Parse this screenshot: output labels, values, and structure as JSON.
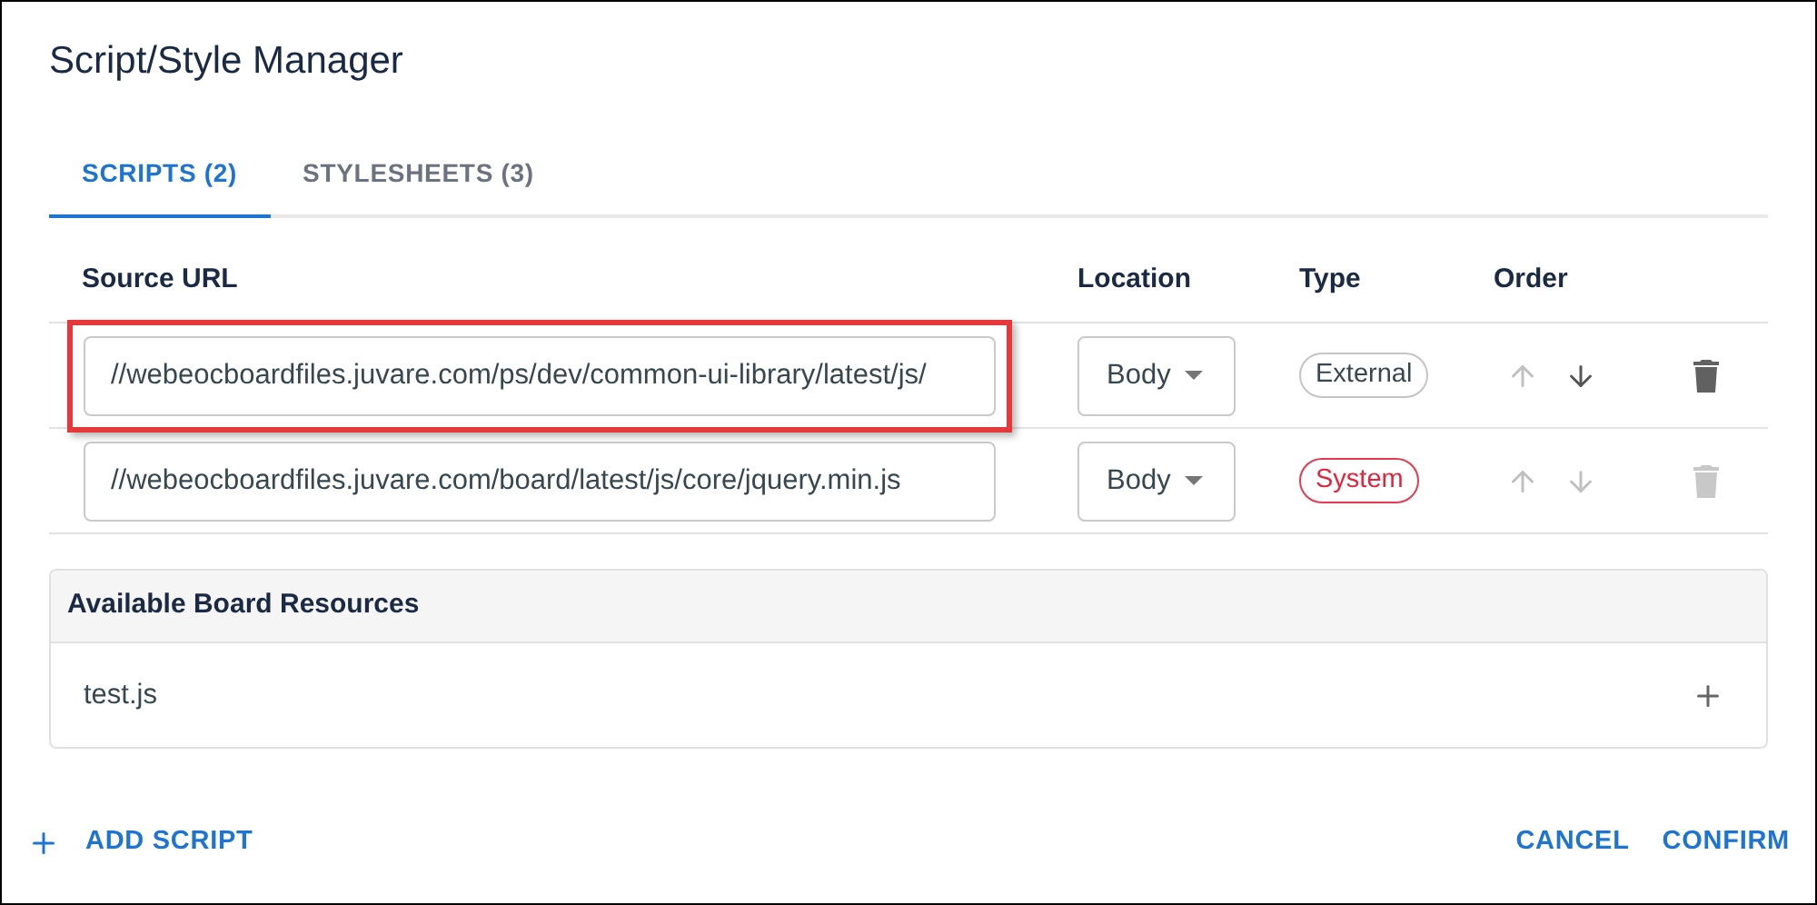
{
  "dialog": {
    "title": "Script/Style Manager"
  },
  "tabs": [
    {
      "label": "SCRIPTS (2)",
      "selected": true
    },
    {
      "label": "STYLESHEETS (3)",
      "selected": false
    }
  ],
  "table": {
    "columns": [
      "Source URL",
      "Location",
      "Type",
      "Order"
    ],
    "rows": [
      {
        "url": "//webeocboardfiles.juvare.com/ps/dev/common-ui-library/latest/js/",
        "highlighted": true,
        "location": "Body",
        "type": {
          "label": "External",
          "kind": "external"
        },
        "up_disabled": true,
        "down_disabled": false,
        "delete_disabled": false
      },
      {
        "url": "//webeocboardfiles.juvare.com/board/latest/js/core/jquery.min.js",
        "highlighted": false,
        "location": "Body",
        "type": {
          "label": "System",
          "kind": "system"
        },
        "up_disabled": true,
        "down_disabled": true,
        "delete_disabled": true
      }
    ]
  },
  "resources": {
    "title": "Available Board Resources",
    "items": [
      "test.js"
    ]
  },
  "footer": {
    "add": "ADD SCRIPT",
    "cancel": "CANCEL",
    "confirm": "CONFIRM"
  }
}
